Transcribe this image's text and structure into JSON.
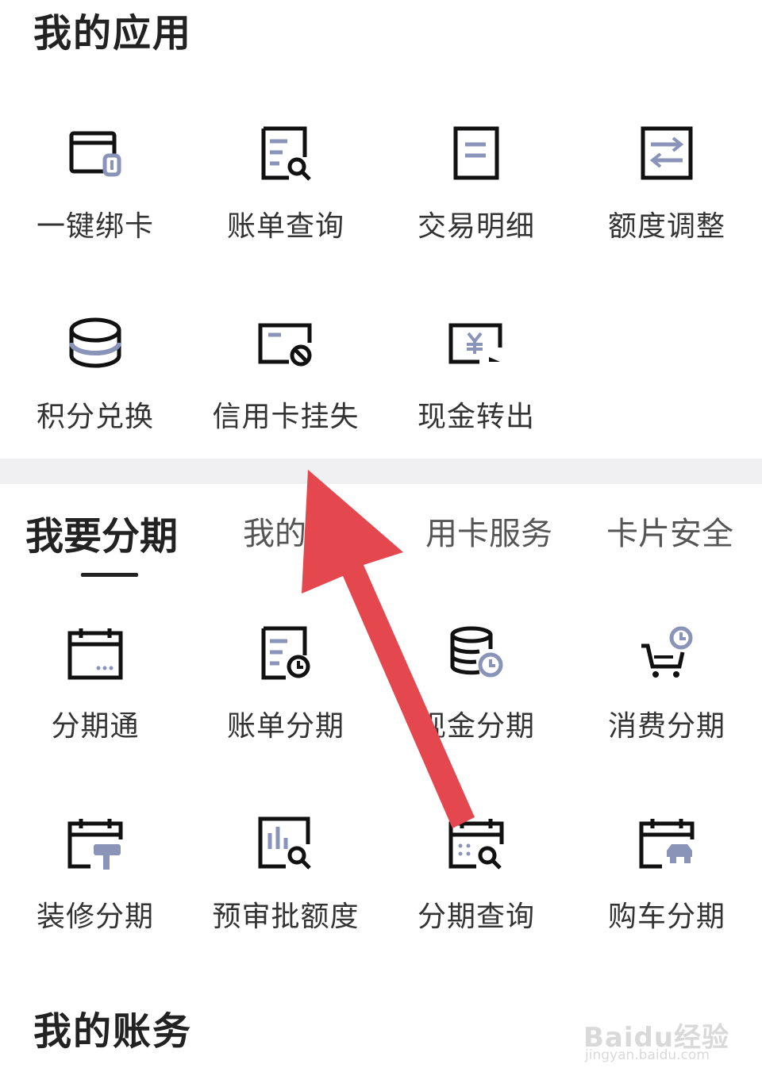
{
  "my_apps": {
    "title": "我的应用",
    "items": [
      {
        "label": "一键绑卡",
        "icon": "bind-card-icon"
      },
      {
        "label": "账单查询",
        "icon": "bill-search-icon"
      },
      {
        "label": "交易明细",
        "icon": "transaction-detail-icon"
      },
      {
        "label": "额度调整",
        "icon": "limit-adjust-icon"
      },
      {
        "label": "积分兑换",
        "icon": "points-exchange-icon"
      },
      {
        "label": "信用卡挂失",
        "icon": "card-report-loss-icon"
      },
      {
        "label": "现金转出",
        "icon": "cash-transfer-icon"
      }
    ]
  },
  "tabs": {
    "items": [
      "我要分期",
      "我的",
      "用卡服务",
      "卡片安全"
    ],
    "active": 0
  },
  "installments": {
    "items": [
      {
        "label": "分期通",
        "icon": "installment-calendar-icon"
      },
      {
        "label": "账单分期",
        "icon": "bill-installment-icon"
      },
      {
        "label": "现金分期",
        "icon": "cash-installment-icon"
      },
      {
        "label": "消费分期",
        "icon": "shopping-cart-installment-icon"
      },
      {
        "label": "装修分期",
        "icon": "decoration-installment-icon"
      },
      {
        "label": "预审批额度",
        "icon": "pre-approval-limit-icon"
      },
      {
        "label": "分期查询",
        "icon": "installment-search-icon"
      },
      {
        "label": "购车分期",
        "icon": "car-installment-icon"
      }
    ]
  },
  "my_accounts": {
    "title": "我的账务"
  },
  "watermark": {
    "brand": "Baidu经验",
    "url": "jingyan.baidu.com"
  },
  "colors": {
    "accent_icon": "#8a93b8",
    "arrow": "#e5474f",
    "divider": "#f0f0f3"
  }
}
